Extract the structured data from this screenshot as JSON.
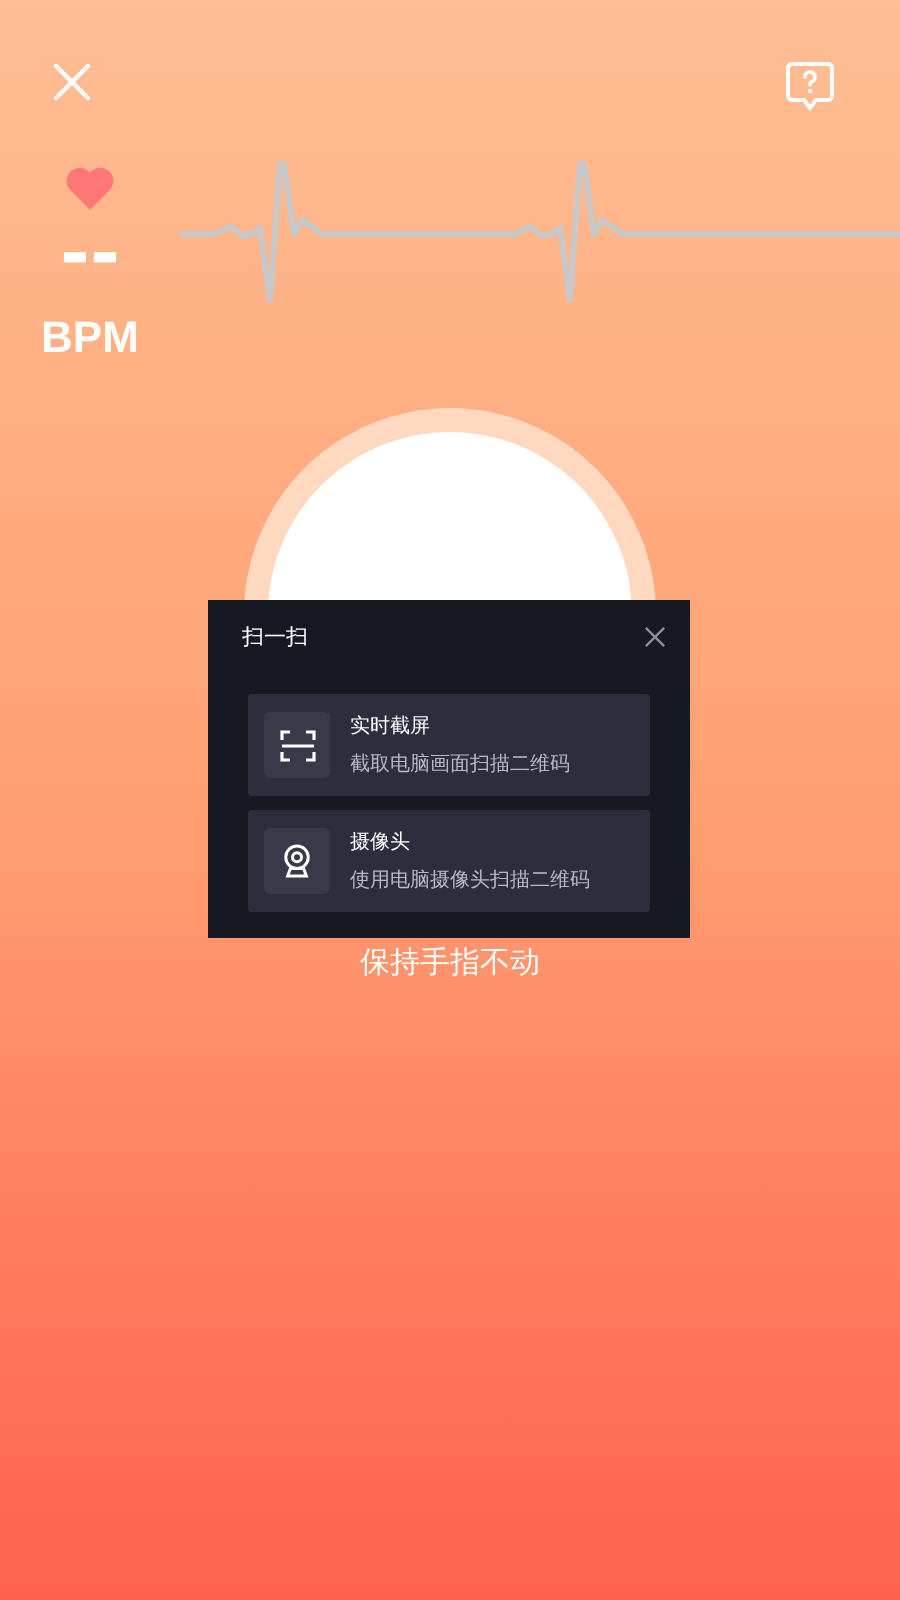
{
  "heart_rate": {
    "value": "--",
    "unit": "BPM"
  },
  "hint": "保持手指不动",
  "dialog": {
    "title": "扫一扫",
    "options": [
      {
        "kind": "screen",
        "title": "实时截屏",
        "description": "截取电脑画面扫描二维码"
      },
      {
        "kind": "camera",
        "title": "摄像头",
        "description": "使用电脑摄像头扫描二维码"
      }
    ]
  }
}
